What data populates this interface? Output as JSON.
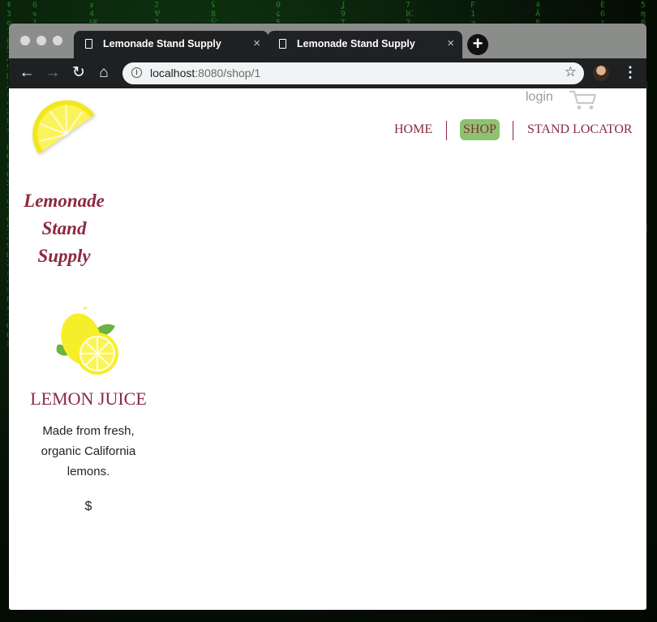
{
  "browser": {
    "tabs": [
      {
        "title": "Lemonade Stand Supply",
        "close": "×"
      },
      {
        "title": "Lemonade Stand Supply",
        "close": "×"
      }
    ],
    "new_tab": "+",
    "nav": {
      "back": "←",
      "forward": "→",
      "reload": "↻",
      "home": "⌂"
    },
    "address": {
      "host": "localhost",
      "rest": ":8080/shop/1"
    },
    "star": "☆",
    "menu": "⋮"
  },
  "header": {
    "login": "login",
    "brand_lines": [
      "Lemonade",
      "Stand",
      "Supply"
    ]
  },
  "nav": {
    "items": [
      {
        "label": "HOME",
        "active": false
      },
      {
        "label": "SHOP",
        "active": true
      },
      {
        "label": "STAND LOCATOR",
        "active": false
      }
    ]
  },
  "product": {
    "name": "LEMON JUICE",
    "description": "Made from fresh, organic California lemons.",
    "price": "$"
  },
  "colors": {
    "brand": "#8b2a3f",
    "active_nav": "#8cc36f",
    "lemon": "#f7ee2a"
  }
}
